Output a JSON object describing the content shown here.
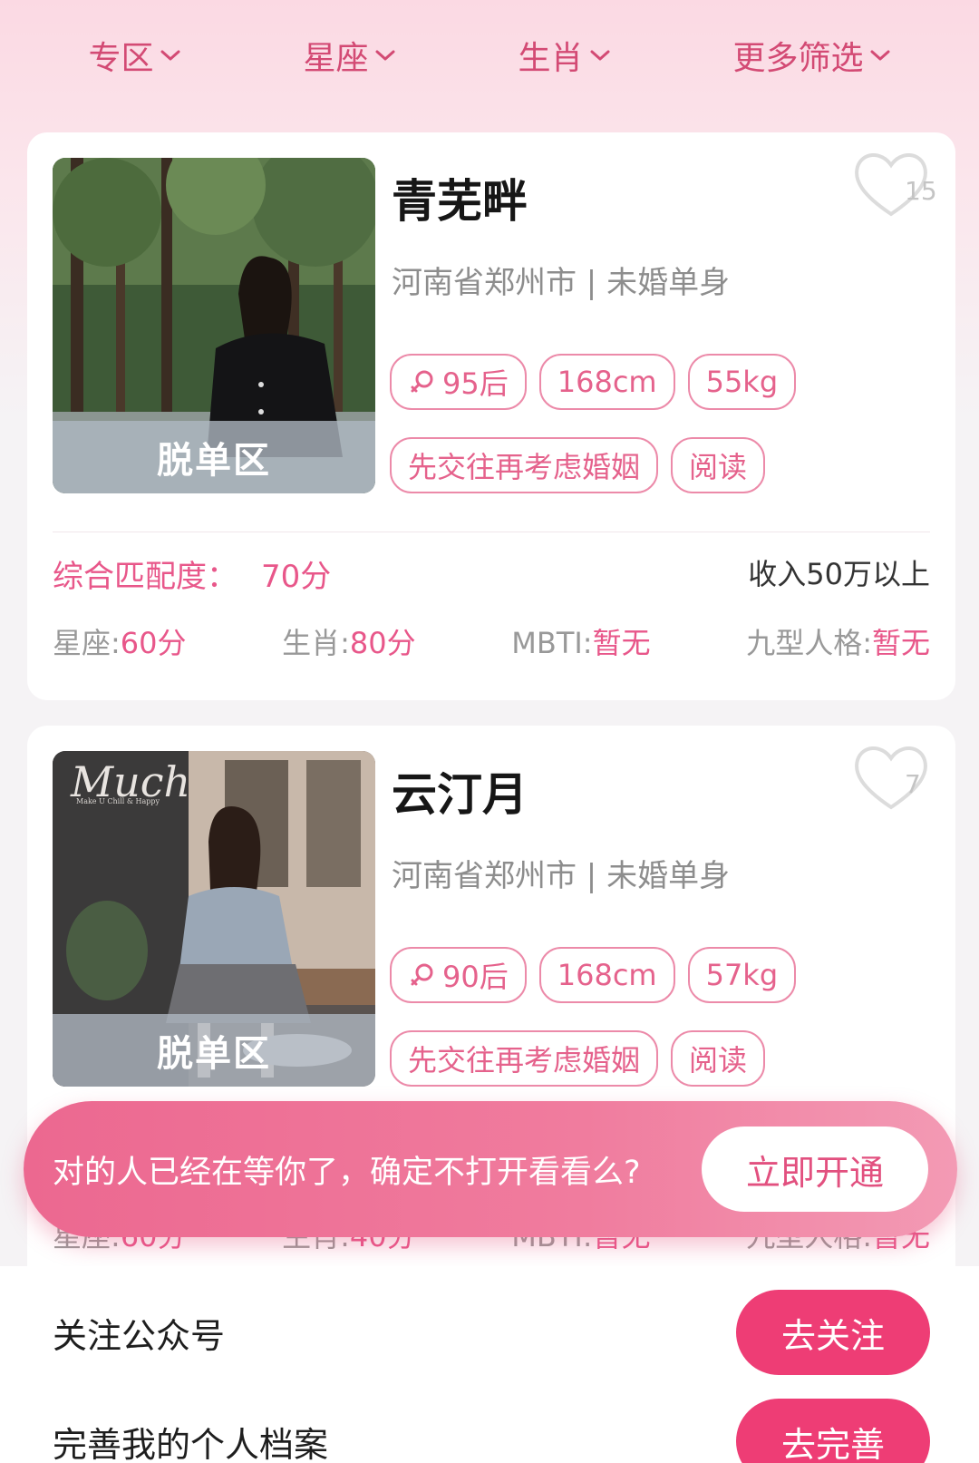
{
  "filters": [
    {
      "label": "专区"
    },
    {
      "label": "星座"
    },
    {
      "label": "生肖"
    },
    {
      "label": "更多筛选"
    }
  ],
  "profiles": [
    {
      "name": "青芜畔",
      "like_count": "15",
      "zone": "脱单区",
      "meta": "河南省郑州市 | 未婚单身",
      "tags_row1": [
        "95后",
        "168cm",
        "55kg"
      ],
      "tags_row2": [
        "先交往再考虑婚姻",
        "阅读"
      ],
      "match_label": "综合匹配度：",
      "match_score": "70分",
      "income": "收入50万以上",
      "scores": [
        {
          "label": "星座:",
          "value": "60分"
        },
        {
          "label": "生肖:",
          "value": "80分"
        },
        {
          "label": "MBTI:",
          "value": "暂无"
        },
        {
          "label": "九型人格:",
          "value": "暂无"
        }
      ]
    },
    {
      "name": "云汀月",
      "like_count": "7",
      "zone": "脱单区",
      "photo_text": "Much",
      "photo_subtext": "Make U Chill & Happy",
      "meta": "河南省郑州市 | 未婚单身",
      "tags_row1": [
        "90后",
        "168cm",
        "57kg"
      ],
      "tags_row2": [
        "先交往再考虑婚姻",
        "阅读"
      ],
      "scores": [
        {
          "label": "星座:",
          "value": "60分"
        },
        {
          "label": "生肖:",
          "value": "40分"
        },
        {
          "label": "MBTI:",
          "value": "暂无"
        },
        {
          "label": "九型人格:",
          "value": "暂无"
        }
      ]
    }
  ],
  "promo": {
    "text": "对的人已经在等你了，确定不打开看看么?",
    "button": "立即开通"
  },
  "tasks": [
    {
      "label": "关注公众号",
      "button": "去关注"
    },
    {
      "label": "完善我的个人档案",
      "button": "去完善"
    }
  ],
  "colors": {
    "accent": "#e8578a",
    "button_pink": "#ee3d75",
    "tag_border": "#ec8aa9"
  }
}
